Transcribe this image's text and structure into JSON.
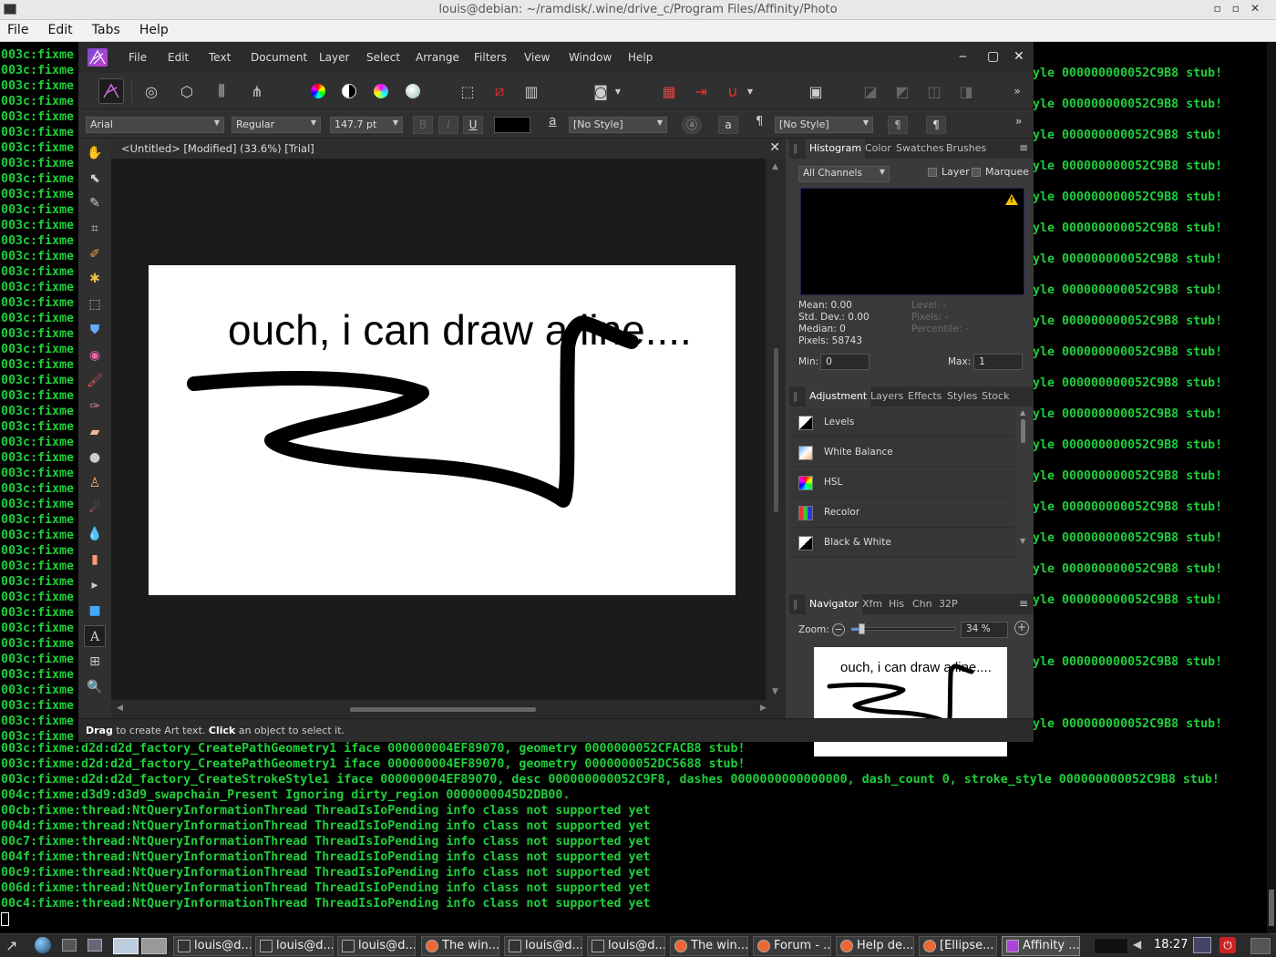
{
  "terminal": {
    "title": "louis@debian: ~/ramdisk/.wine/drive_c/Program Files/Affinity/Photo",
    "menu": [
      "File",
      "Edit",
      "Tabs",
      "Help"
    ],
    "left_prefix": "003c:fixme",
    "right_fragment": "yle 000000000052C9B8 stub!",
    "bottom_lines": [
      "003c:fixme:d2d:d2d_factory_CreatePathGeometry1 iface 000000004EF89070, geometry 0000000052CFACB8 stub!",
      "003c:fixme:d2d:d2d_factory_CreatePathGeometry1 iface 000000004EF89070, geometry 0000000052DC5688 stub!",
      "003c:fixme:d2d:d2d_factory_CreateStrokeStyle1 iface 000000004EF89070, desc 000000000052C9F8, dashes 0000000000000000, dash_count 0, stroke_style 000000000052C9B8 stub!",
      "004c:fixme:d3d9:d3d9_swapchain_Present Ignoring dirty_region 0000000045D2DB00.",
      "00cb:fixme:thread:NtQueryInformationThread ThreadIsIoPending info class not supported yet",
      "004d:fixme:thread:NtQueryInformationThread ThreadIsIoPending info class not supported yet",
      "00c7:fixme:thread:NtQueryInformationThread ThreadIsIoPending info class not supported yet",
      "004f:fixme:thread:NtQueryInformationThread ThreadIsIoPending info class not supported yet",
      "00c9:fixme:thread:NtQueryInformationThread ThreadIsIoPending info class not supported yet",
      "006d:fixme:thread:NtQueryInformationThread ThreadIsIoPending info class not supported yet",
      "00c4:fixme:thread:NtQueryInformationThread ThreadIsIoPending info class not supported yet"
    ]
  },
  "affinity": {
    "menu": [
      "File",
      "Edit",
      "Text",
      "Document",
      "Layer",
      "Select",
      "Arrange",
      "Filters",
      "View",
      "Window",
      "Help"
    ],
    "context": {
      "font": "Arial",
      "style": "Regular",
      "size": "147.7 pt",
      "bold": "B",
      "italic": "I",
      "underline": "U",
      "char_style": "[No Style]",
      "para_style": "[No Style]",
      "a_glyph": "a",
      "pilcrow": "¶"
    },
    "doc_tab": "<Untitled> [Modified] (33.6%) [Trial]",
    "canvas_text": "ouch, i can draw a line....",
    "status": {
      "drag": "Drag",
      "drag_desc": " to create Art text. ",
      "click": "Click",
      "click_desc": " an object to select it."
    },
    "histogram": {
      "tabs": [
        "Histogram",
        "Color",
        "Swatches",
        "Brushes"
      ],
      "channel": "All Channels",
      "layer_label": "Layer",
      "marquee_label": "Marquee",
      "warning_glyph": "!",
      "stats_left": [
        "Mean: 0.00",
        "Std. Dev.: 0.00",
        "Median: 0",
        "Pixels: 58743"
      ],
      "stats_right": [
        "Level: -",
        "Pixels: -",
        "Percentile: -"
      ],
      "min_label": "Min:",
      "min": "0",
      "max_label": "Max:",
      "max": "1"
    },
    "adjustment": {
      "tabs": [
        "Adjustment",
        "Layers",
        "Effects",
        "Styles",
        "Stock"
      ],
      "items": [
        "Levels",
        "White Balance",
        "HSL",
        "Recolor",
        "Black & White"
      ]
    },
    "navigator": {
      "tabs": [
        "Navigator",
        "Xfm",
        "His",
        "Chn",
        "32P"
      ],
      "zoom_label": "Zoom:",
      "zoom": "34 %",
      "zoom_level": 0.07,
      "preview_text": "ouch, i can draw a line...."
    }
  },
  "taskbar": {
    "items": [
      "louis@d...",
      "louis@d...",
      "louis@d...",
      "The win...",
      "louis@d...",
      "louis@d...",
      "The win...",
      "Forum - ...",
      "Help de...",
      "[Ellipse...",
      "Affinity ..."
    ],
    "clock": "18:27"
  },
  "colors": {
    "terminal_green": "#1fcf3a",
    "affinity_bg": "#3a3a3a",
    "warning": "#f5c400"
  }
}
